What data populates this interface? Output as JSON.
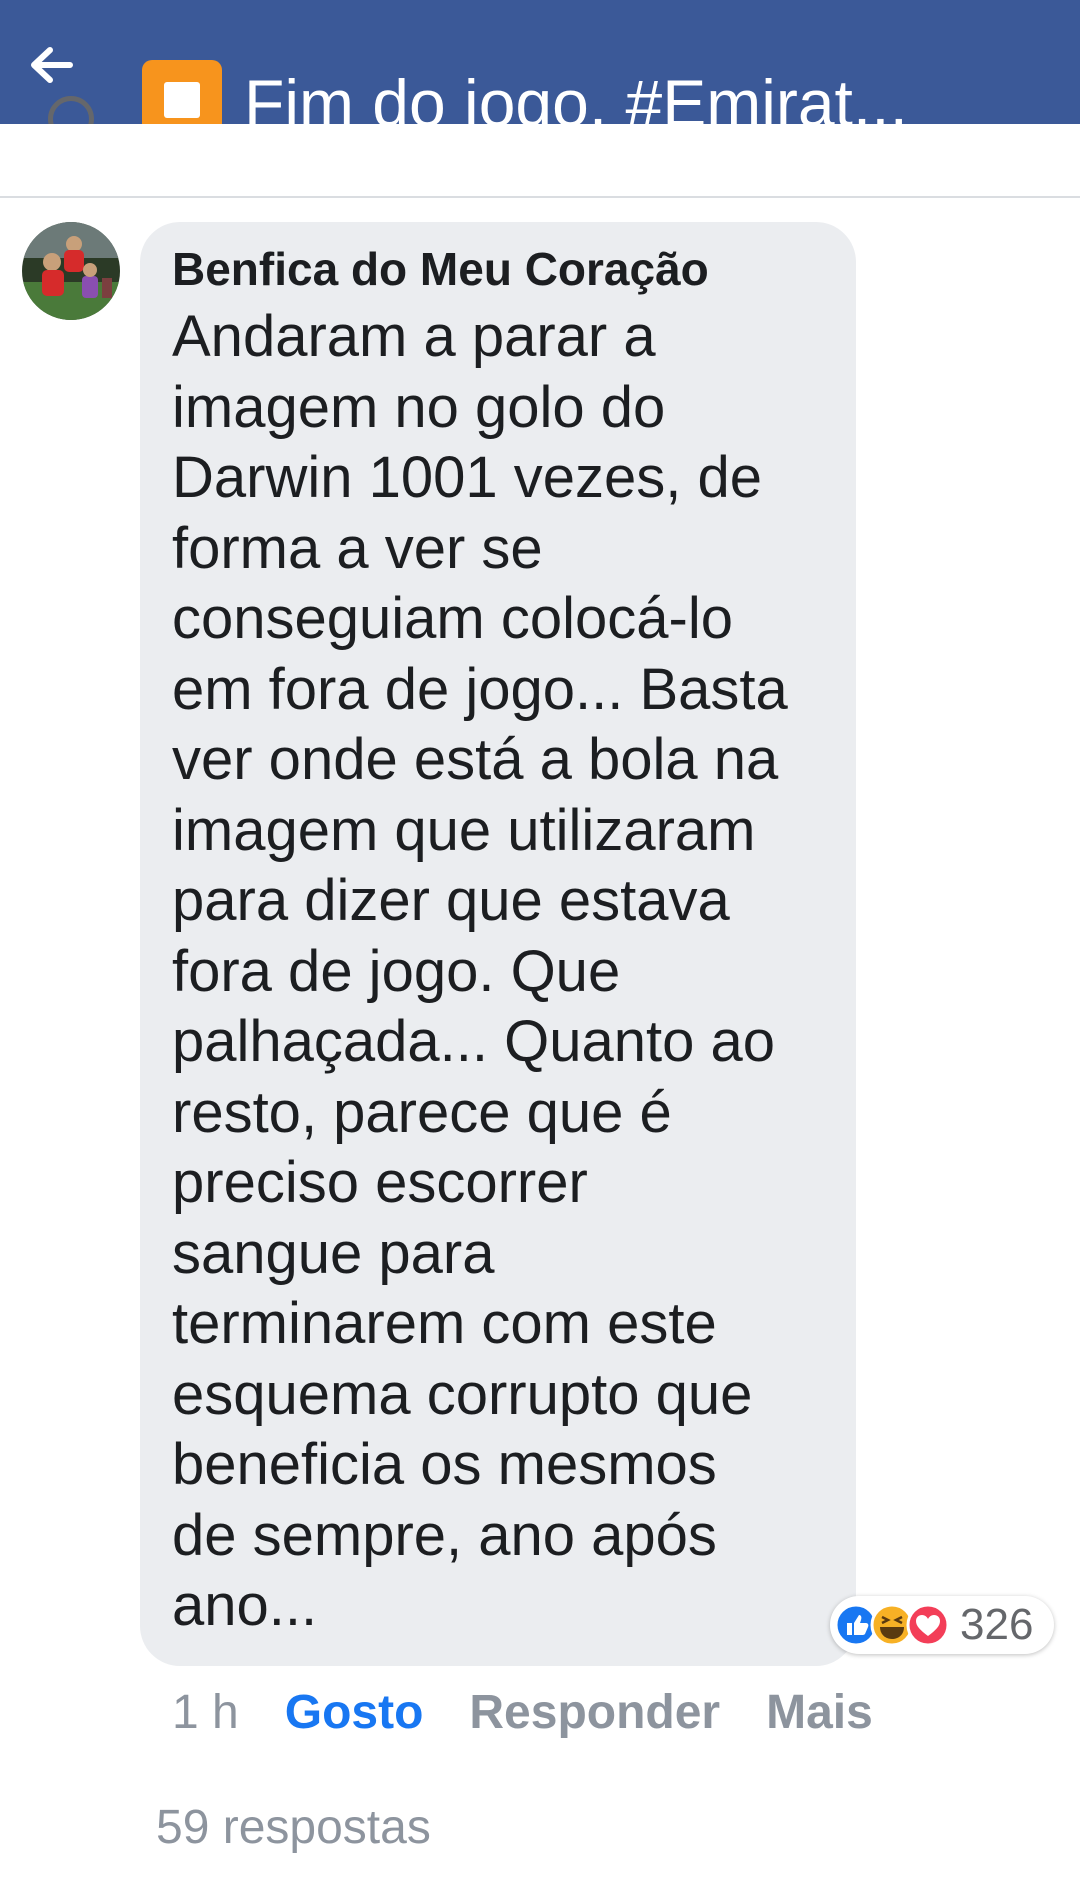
{
  "header": {
    "title": "Fim do jogo. #Emirat...",
    "back_icon": "arrow-left-icon",
    "title_emoji": "stop-button-emoji",
    "background_color": "#3b5998"
  },
  "comment": {
    "author": "Benfica do Meu Coração",
    "text": "Andaram a parar a\nimagem no golo do\nDarwin 1001 vezes, de\nforma a ver se\nconseguiam colocá-lo\nem fora de jogo... Basta\nver onde está a bola na\nimagem que utilizaram\npara dizer que estava\nfora de jogo. Que\npalhaçada... Quanto ao\nresto, parece que é\npreciso escorrer\nsangue para\nterminarem com este\nesquema corrupto que\nbeneficia os mesmos\nde sempre, ano após\nano...",
    "reactions": {
      "icons": [
        "like-icon",
        "haha-icon",
        "love-icon"
      ],
      "count": "326"
    },
    "bubble_color": "#ebedf0"
  },
  "actions": {
    "time": "1 h",
    "like": "Gosto",
    "reply": "Responder",
    "more": "Mais",
    "like_color": "#1877f2"
  },
  "replies": {
    "label": "59 respostas"
  }
}
